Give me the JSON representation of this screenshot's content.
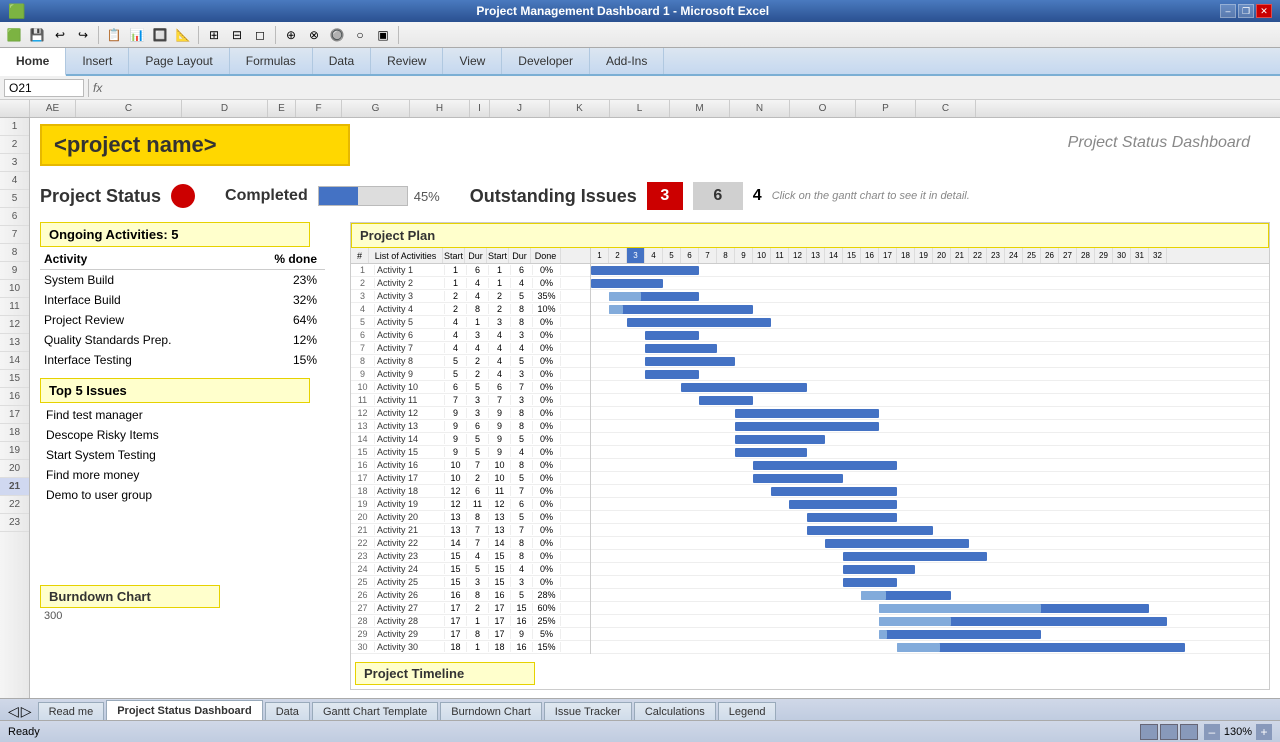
{
  "titlebar": {
    "title": "Project Management Dashboard 1 - Microsoft Excel",
    "min": "–",
    "restore": "❐",
    "close": "✕"
  },
  "ribbon": {
    "tabs": [
      "Home",
      "Insert",
      "Page Layout",
      "Formulas",
      "Data",
      "Review",
      "View",
      "Developer",
      "Add-Ins"
    ]
  },
  "active_tab": "Home",
  "formula_bar": {
    "cell": "O21",
    "formula": ""
  },
  "dashboard": {
    "project_name": "<project name>",
    "title": "Project Status Dashboard",
    "status": {
      "label": "Project Status",
      "completed_label": "Completed",
      "completed_pct": "45%",
      "progress_fill": 45,
      "issues_label": "Outstanding Issues",
      "issues_red": "3",
      "issues_gray": "6",
      "issues_num": "4"
    },
    "ongoing": {
      "header": "Ongoing Activities: 5",
      "col1": "Activity",
      "col2": "% done",
      "rows": [
        {
          "activity": "System Build",
          "pct": "23%"
        },
        {
          "activity": "Interface Build",
          "pct": "32%"
        },
        {
          "activity": "Project Review",
          "pct": "64%"
        },
        {
          "activity": "Quality Standards Prep.",
          "pct": "12%"
        },
        {
          "activity": "Interface Testing",
          "pct": "15%"
        }
      ]
    },
    "top_issues": {
      "header": "Top 5 Issues",
      "rows": [
        "Find test manager",
        "Descope Risky Items",
        "Start System Testing",
        "Find more money",
        "Demo to user group"
      ]
    },
    "project_plan": {
      "header": "Project Plan",
      "col_headers": [
        "#",
        "List of Activities",
        "Start",
        "Dur",
        "Start",
        "Dur",
        "Done"
      ],
      "gantt_headers": [
        "1",
        "2",
        "3",
        "4",
        "5",
        "6",
        "7",
        "8",
        "9",
        "10",
        "11",
        "12",
        "13",
        "14",
        "15",
        "16",
        "17",
        "18",
        "19",
        "20",
        "21",
        "22",
        "23",
        "24",
        "25",
        "26",
        "27",
        "28",
        "29",
        "30",
        "31",
        "32"
      ],
      "rows": [
        {
          "n": "1",
          "name": "Activity 1",
          "s1": 1,
          "d1": 6,
          "s2": 1,
          "d2": 6,
          "done": "0%"
        },
        {
          "n": "2",
          "name": "Activity 2",
          "s1": 1,
          "d1": 4,
          "s2": 1,
          "d2": 4,
          "done": "0%"
        },
        {
          "n": "3",
          "name": "Activity 3",
          "s1": 2,
          "d1": 4,
          "s2": 2,
          "d2": 5,
          "done": "35%"
        },
        {
          "n": "4",
          "name": "Activity 4",
          "s1": 2,
          "d1": 8,
          "s2": 2,
          "d2": 8,
          "done": "10%"
        },
        {
          "n": "5",
          "name": "Activity 5",
          "s1": 4,
          "d1": 1,
          "s2": 3,
          "d2": 8,
          "done": "0%"
        },
        {
          "n": "6",
          "name": "Activity 6",
          "s1": 4,
          "d1": 3,
          "s2": 4,
          "d2": 3,
          "done": "0%"
        },
        {
          "n": "7",
          "name": "Activity 7",
          "s1": 4,
          "d1": 4,
          "s2": 4,
          "d2": 4,
          "done": "0%"
        },
        {
          "n": "8",
          "name": "Activity 8",
          "s1": 5,
          "d1": 2,
          "s2": 4,
          "d2": 5,
          "done": "0%"
        },
        {
          "n": "9",
          "name": "Activity 9",
          "s1": 5,
          "d1": 2,
          "s2": 4,
          "d2": 3,
          "done": "0%"
        },
        {
          "n": "10",
          "name": "Activity 10",
          "s1": 6,
          "d1": 5,
          "s2": 6,
          "d2": 7,
          "done": "0%"
        },
        {
          "n": "11",
          "name": "Activity 11",
          "s1": 7,
          "d1": 3,
          "s2": 7,
          "d2": 3,
          "done": "0%"
        },
        {
          "n": "12",
          "name": "Activity 12",
          "s1": 9,
          "d1": 3,
          "s2": 9,
          "d2": 8,
          "done": "0%"
        },
        {
          "n": "13",
          "name": "Activity 13",
          "s1": 9,
          "d1": 6,
          "s2": 9,
          "d2": 8,
          "done": "0%"
        },
        {
          "n": "14",
          "name": "Activity 14",
          "s1": 9,
          "d1": 5,
          "s2": 9,
          "d2": 5,
          "done": "0%"
        },
        {
          "n": "15",
          "name": "Activity 15",
          "s1": 9,
          "d1": 5,
          "s2": 9,
          "d2": 4,
          "done": "0%"
        },
        {
          "n": "16",
          "name": "Activity 16",
          "s1": 10,
          "d1": 7,
          "s2": 10,
          "d2": 8,
          "done": "0%"
        },
        {
          "n": "17",
          "name": "Activity 17",
          "s1": 10,
          "d1": 2,
          "s2": 10,
          "d2": 5,
          "done": "0%"
        },
        {
          "n": "18",
          "name": "Activity 18",
          "s1": 12,
          "d1": 6,
          "s2": 11,
          "d2": 7,
          "done": "0%"
        },
        {
          "n": "19",
          "name": "Activity 19",
          "s1": 12,
          "d1": 11,
          "s2": 12,
          "d2": 6,
          "done": "0%"
        },
        {
          "n": "20",
          "name": "Activity 20",
          "s1": 13,
          "d1": 8,
          "s2": 13,
          "d2": 5,
          "done": "0%"
        },
        {
          "n": "21",
          "name": "Activity 21",
          "s1": 13,
          "d1": 7,
          "s2": 13,
          "d2": 7,
          "done": "0%"
        },
        {
          "n": "22",
          "name": "Activity 22",
          "s1": 14,
          "d1": 7,
          "s2": 14,
          "d2": 8,
          "done": "0%"
        },
        {
          "n": "23",
          "name": "Activity 23",
          "s1": 15,
          "d1": 4,
          "s2": 15,
          "d2": 8,
          "done": "0%"
        },
        {
          "n": "24",
          "name": "Activity 24",
          "s1": 15,
          "d1": 5,
          "s2": 15,
          "d2": 4,
          "done": "0%"
        },
        {
          "n": "25",
          "name": "Activity 25",
          "s1": 15,
          "d1": 3,
          "s2": 15,
          "d2": 3,
          "done": "0%"
        },
        {
          "n": "26",
          "name": "Activity 26",
          "s1": 16,
          "d1": 8,
          "s2": 16,
          "d2": 5,
          "done": "28%"
        },
        {
          "n": "27",
          "name": "Activity 27",
          "s1": 17,
          "d1": 2,
          "s2": 17,
          "d2": 15,
          "done": "60%"
        },
        {
          "n": "28",
          "name": "Activity 28",
          "s1": 17,
          "d1": 1,
          "s2": 17,
          "d2": 16,
          "done": "25%"
        },
        {
          "n": "29",
          "name": "Activity 29",
          "s1": 17,
          "d1": 8,
          "s2": 17,
          "d2": 9,
          "done": "5%"
        },
        {
          "n": "30",
          "name": "Activity 30",
          "s1": 18,
          "d1": 1,
          "s2": 18,
          "d2": 16,
          "done": "15%"
        }
      ]
    },
    "burndown_chart": {
      "header": "Burndown Chart",
      "y_start": "300"
    },
    "project_timeline": {
      "header": "Project Timeline"
    },
    "click_hint": "Click on the gantt chart to see it in detail."
  },
  "sheets": [
    "Read me",
    "Project Status Dashboard",
    "Data",
    "Gantt Chart Template",
    "Burndown Chart",
    "Issue Tracker",
    "Calculations",
    "Legend"
  ],
  "active_sheet": "Project Status Dashboard",
  "statusbar": {
    "ready": "Ready",
    "zoom": "130%"
  }
}
